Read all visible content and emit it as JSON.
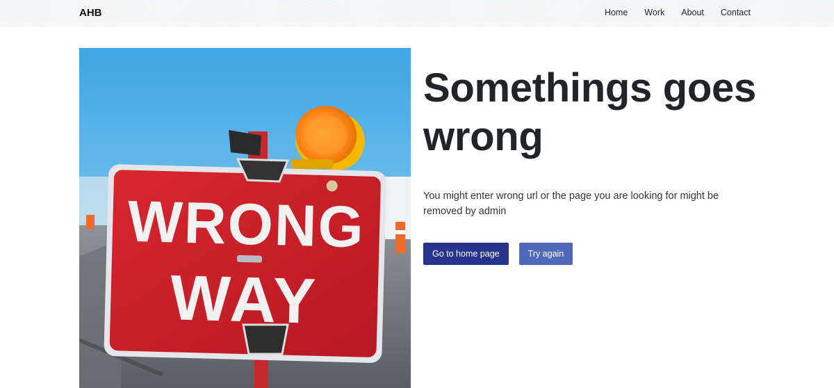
{
  "navbar": {
    "brand": "AHB",
    "links": [
      {
        "label": "Home"
      },
      {
        "label": "Work"
      },
      {
        "label": "About"
      },
      {
        "label": "Contact"
      }
    ]
  },
  "hero": {
    "image_alt": "Wrong way road sign",
    "sign_text": [
      "WRONG",
      "WAY"
    ],
    "title": "Somethings goes wrong",
    "message": "You might enter wrong url or the page you are looking for might be removed by admin",
    "primary_button": "Go to home page",
    "secondary_button": "Try again"
  },
  "colors": {
    "primary": "#26348d",
    "secondary": "#4f68b8",
    "sign_red": "#d0202a"
  }
}
